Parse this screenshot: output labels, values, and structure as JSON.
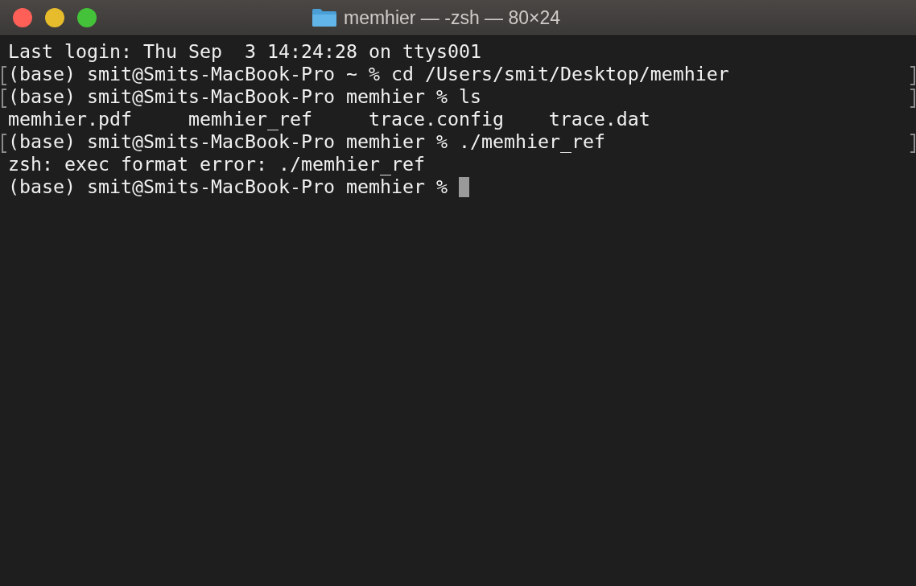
{
  "window": {
    "title": "memhier — -zsh — 80×24"
  },
  "lines": [
    {
      "kind": "text",
      "text": "Last login: Thu Sep  3 14:24:28 on ttys001",
      "marked": false,
      "cursor": false
    },
    {
      "kind": "text",
      "text": "(base) smit@Smits-MacBook-Pro ~ % cd /Users/smit/Desktop/memhier",
      "marked": true,
      "cursor": false
    },
    {
      "kind": "text",
      "text": "(base) smit@Smits-MacBook-Pro memhier % ls",
      "marked": true,
      "cursor": false
    },
    {
      "kind": "columns",
      "items": [
        "memhier.pdf",
        "memhier_ref",
        "trace.config",
        "trace.dat"
      ],
      "marked": false,
      "cursor": false
    },
    {
      "kind": "text",
      "text": "(base) smit@Smits-MacBook-Pro memhier % ./memhier_ref",
      "marked": true,
      "cursor": false
    },
    {
      "kind": "text",
      "text": "zsh: exec format error: ./memhier_ref",
      "marked": false,
      "cursor": false
    },
    {
      "kind": "text",
      "text": "(base) smit@Smits-MacBook-Pro memhier % ",
      "marked": false,
      "cursor": true
    }
  ]
}
